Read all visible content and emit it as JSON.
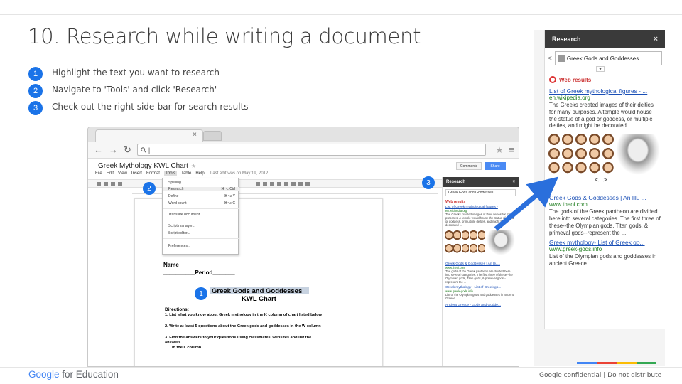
{
  "slide": {
    "title": "10. Research while writing a document"
  },
  "steps": [
    {
      "num": "1",
      "text": "Highlight the text you want to research"
    },
    {
      "num": "2",
      "text": "Navigate to 'Tools' and click 'Research'"
    },
    {
      "num": "3",
      "text": "Check out the right side-bar for search results"
    }
  ],
  "browser": {
    "close": "×",
    "back": "←",
    "forward": "→",
    "reload": "↻",
    "omnibox": "|",
    "star": "★",
    "menu": "≡"
  },
  "doc": {
    "title": "Greek Mythology KWL Chart",
    "menus": [
      "File",
      "Edit",
      "View",
      "Insert",
      "Format",
      "Tools",
      "Table",
      "Help"
    ],
    "last_edit": "Last edit was on May 19, 2012",
    "comments": "Comments",
    "share": "Share",
    "tools_menu": [
      {
        "label": "Spelling...",
        "shortcut": ""
      },
      {
        "label": "Research",
        "shortcut": "⌘⌥ Ctrl"
      },
      {
        "label": "Define",
        "shortcut": "⌘⌥ Y"
      },
      {
        "label": "Word count",
        "shortcut": "⌘⌥ C"
      },
      {
        "label": "Translate document...",
        "shortcut": ""
      },
      {
        "label": "Script manager...",
        "shortcut": ""
      },
      {
        "label": "Script editor...",
        "shortcut": ""
      },
      {
        "label": "Preferences...",
        "shortcut": ""
      }
    ],
    "name_label": "Name_________________________________",
    "period_label": "__________Period_______",
    "heading1": "Greek Gods and Goddesses",
    "heading2": "KWL Chart",
    "directions": "Directions:",
    "dir1": "1.  List what you know about Greek mythology in the K column of chart listed below",
    "dir2": "2.  Write at least 5 questions about the Greek gods and goddesses in the W column",
    "dir3": "3.  Find the answers to your questions using classmates' websites and list the answers",
    "dir3b": "in the L column"
  },
  "small_sidebar": {
    "header": "Research",
    "close": "×",
    "search": "Greek Gods and Goddesses",
    "web_results": "Web results",
    "r1_link": "List of Greek mythological figures -",
    "r1_url": "en.wikipedia.org",
    "r1_text": "The Greeks created images of their deities for many purposes. A temple would house the statue of a god or goddess, or multiple deities, and might be decorated ...",
    "r2_link": "Greek Gods & Goddesses | An Illu...",
    "r2_url": "www.theoi.com",
    "r2_text": "The gods of the Greek pantheon are divided here into several categories. The first three of these--the Olympian gods, Titan gods, & primeval gods--represent the ...",
    "r3_link": "Greek mythology - List of Greek go...",
    "r3_url": "www.greek-gods.info",
    "r3_text": "List of the Olympian gods and goddesses in ancient Greece.",
    "r4_link": "Ancient Greece - Gods and Godde..."
  },
  "big_sidebar": {
    "header": "Research",
    "close": "×",
    "search": "Greek Gods and Goddesses",
    "dropdown": "▾",
    "web_results": "Web results",
    "r1_link": "List of Greek mythological figures - ...",
    "r1_url": "en.wikipedia.org",
    "r1_text": "The Greeks created images of their deities for many purposes. A temple would house the statue of a god or goddess, or multiple deities, and might be decorated ...",
    "prev": "<",
    "next": ">",
    "r2_link": "Greek Gods & Goddesses | An Illu ...",
    "r2_url": "www.theoi.com",
    "r2_text": "The gods of the Greek pantheon are divided here into several categories. The first three of these--the Olympian gods, Titan gods, & primeval gods--represent the ...",
    "r3_link": "Greek mythology- List of Greek go...",
    "r3_url": "www.greek-gods.info",
    "r3_text": "List of the Olympian gods and goddesses in ancient Greece."
  },
  "badges": [
    "1",
    "2",
    "3"
  ],
  "footer": {
    "logo_google": "Google",
    "logo_edu": " for Education",
    "confidential": "Google confidential | Do not distribute"
  },
  "colors": {
    "accent": "#1a73e8",
    "arrow": "#2a6fdc"
  }
}
